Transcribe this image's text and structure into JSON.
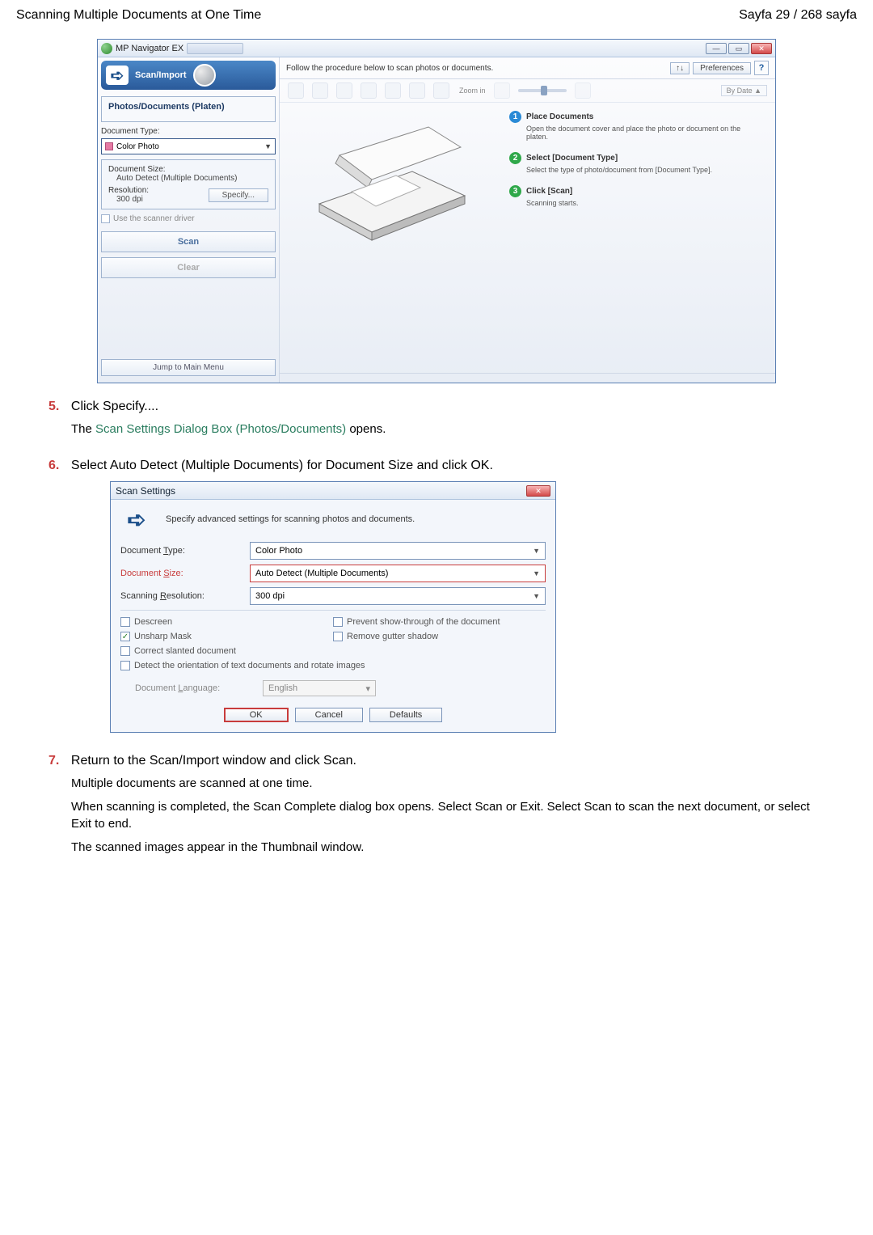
{
  "header": {
    "title": "Scanning Multiple Documents at One Time",
    "page": "Sayfa 29 / 268 sayfa"
  },
  "mp_window": {
    "app_title": "MP Navigator EX",
    "scan_import_label": "Scan/Import",
    "left_panel_title": "Photos/Documents (Platen)",
    "doc_type_label": "Document Type:",
    "doc_type_value": "Color Photo",
    "doc_size_label": "Document Size:",
    "doc_size_value": "Auto Detect (Multiple Documents)",
    "resolution_label": "Resolution:",
    "resolution_value": "300 dpi",
    "specify_btn": "Specify...",
    "use_driver_label": "Use the scanner driver",
    "scan_btn": "Scan",
    "clear_btn": "Clear",
    "jump_btn": "Jump to Main Menu",
    "toolbar_text": "Follow the procedure below to scan photos or documents.",
    "sort_btn": "↑↓",
    "prefs_btn": "Preferences",
    "help_btn": "?",
    "zoom_label": "Zoom in",
    "bydate_label": "By Date ▲",
    "steps": {
      "1": {
        "title": "Place Documents",
        "sub": "Open the document cover and place the photo or document on the platen."
      },
      "2": {
        "title": "Select [Document Type]",
        "sub": "Select the type of photo/document from [Document Type]."
      },
      "3": {
        "title": "Click [Scan]",
        "sub": "Scanning starts."
      }
    }
  },
  "steps_text": {
    "5": {
      "main": "Click Specify....",
      "sub_prefix": "The ",
      "sub_link": "Scan Settings Dialog Box (Photos/Documents)",
      "sub_suffix": " opens."
    },
    "6": {
      "main": "Select Auto Detect (Multiple Documents) for Document Size and click OK."
    },
    "7": {
      "main": "Return to the Scan/Import window and click Scan.",
      "sub1": "Multiple documents are scanned at one time.",
      "sub2": "When scanning is completed, the Scan Complete dialog box opens. Select Scan or Exit. Select Scan to scan the next document, or select Exit to end.",
      "sub3": "The scanned images appear in the Thumbnail window."
    }
  },
  "scan_settings": {
    "title": "Scan Settings",
    "intro": "Specify advanced settings for scanning photos and documents.",
    "rows": {
      "doc_type": {
        "label": "Document Type:",
        "value": "Color Photo"
      },
      "doc_size": {
        "label": "Document Size:",
        "value": "Auto Detect (Multiple Documents)"
      },
      "resolution": {
        "label": "Scanning Resolution:",
        "value": "300 dpi"
      }
    },
    "checks": {
      "descreen": "Descreen",
      "prevent": "Prevent show-through of the document",
      "unsharp": "Unsharp Mask",
      "gutter": "Remove gutter shadow",
      "slanted": "Correct slanted document",
      "orient": "Detect the orientation of text documents and rotate images"
    },
    "lang_label": "Document Language:",
    "lang_value": "English",
    "ok": "OK",
    "cancel": "Cancel",
    "defaults": "Defaults"
  }
}
